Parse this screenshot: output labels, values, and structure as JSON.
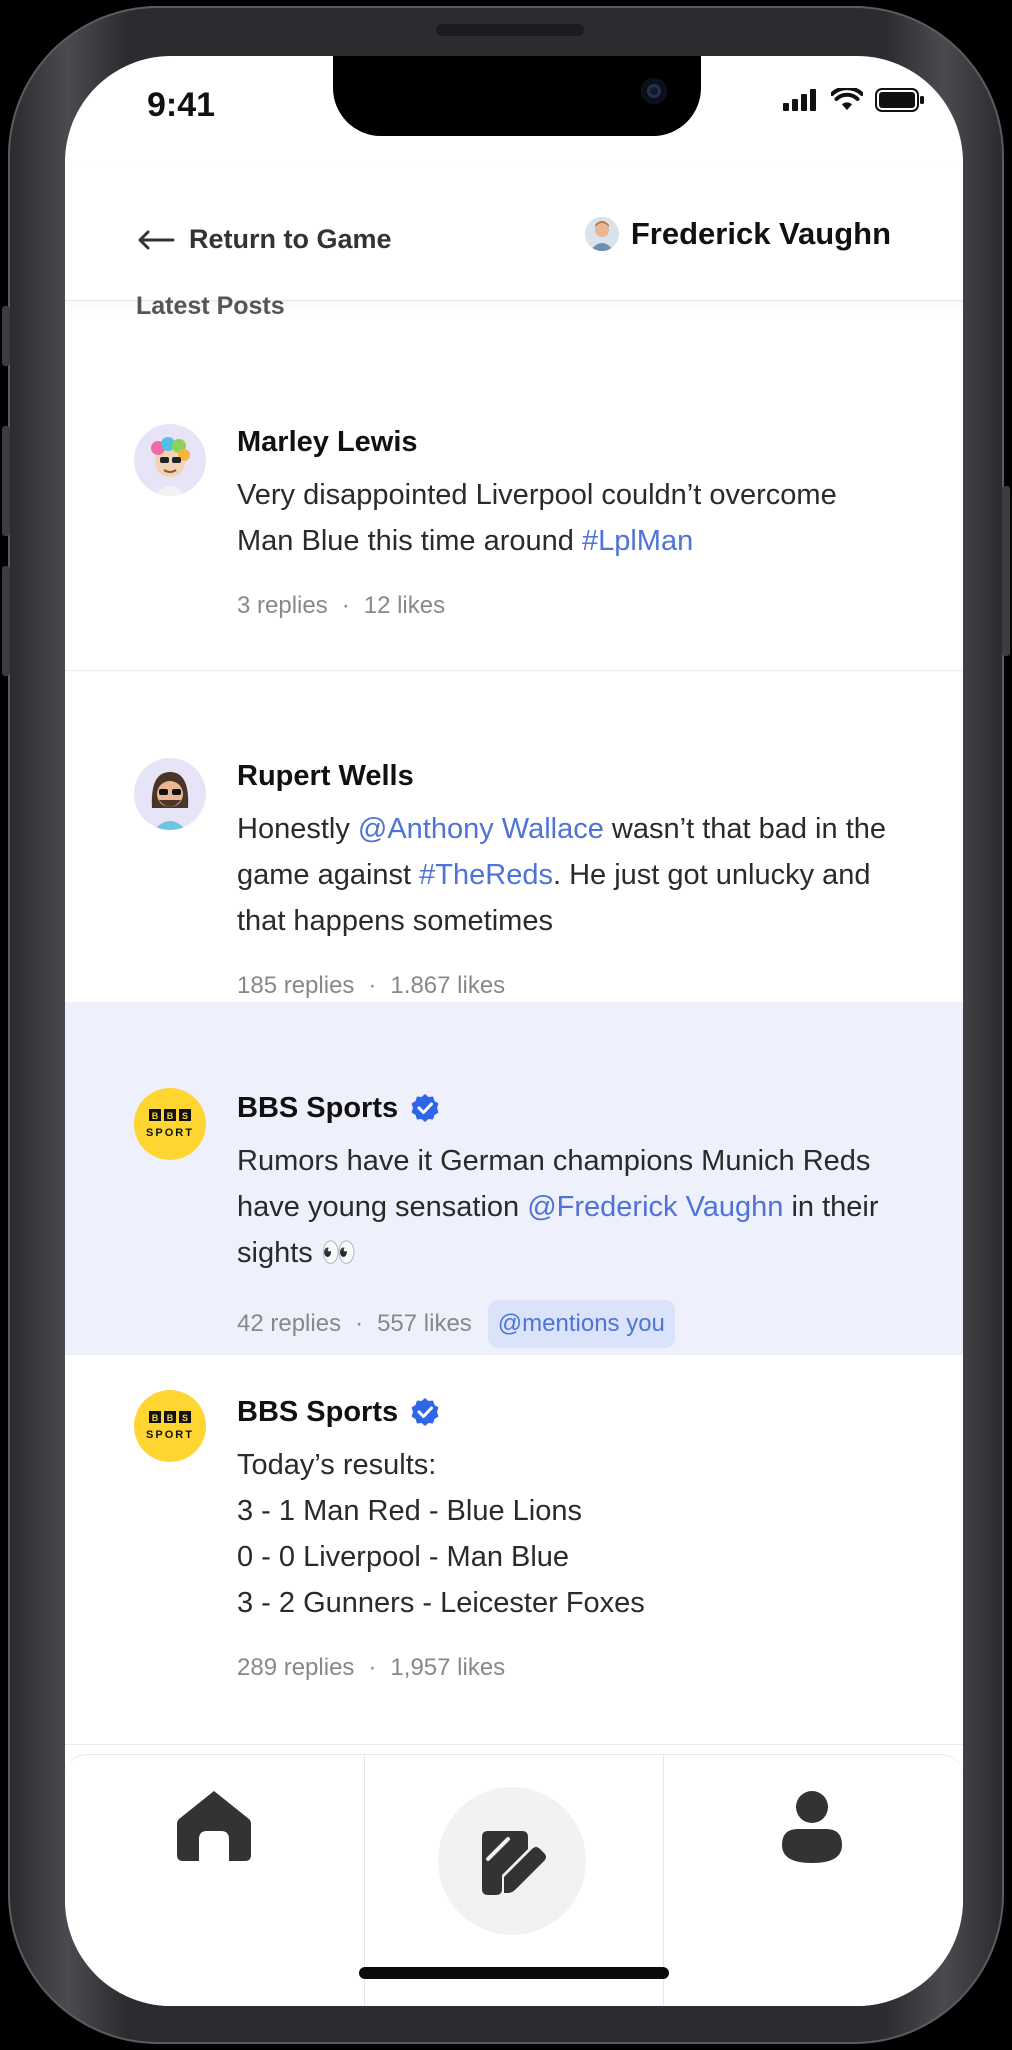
{
  "status": {
    "time": "9:41"
  },
  "header": {
    "back_label": "Return to Game",
    "user_name": "Frederick Vaughn"
  },
  "section_title": "Latest Posts",
  "posts": [
    {
      "author": "Marley Lewis",
      "verified": false,
      "text_parts": [
        "Very disappointed Liverpool couldn’t overcome Man Blue this time around ",
        "#LplMan"
      ],
      "replies": "3 replies",
      "likes": "12 likes"
    },
    {
      "author": "Rupert Wells",
      "verified": false,
      "text_parts": [
        "Honestly ",
        "@Anthony Wallace",
        " wasn’t that bad in the game against ",
        "#TheReds",
        ". He just got unlucky and that happens sometimes"
      ],
      "replies": "185 replies",
      "likes": "1.867 likes"
    },
    {
      "author": "BBS Sports",
      "verified": true,
      "text_parts": [
        "Rumors have it German champions Munich Reds have young sensation ",
        "@Frederick Vaughn",
        " in their sights 👀"
      ],
      "replies": "42 replies",
      "likes": "557 likes",
      "chip": "@mentions you"
    },
    {
      "author": "BBS Sports",
      "verified": true,
      "text_lines": [
        "Today’s results:",
        "3 - 1 Man Red - Blue Lions",
        "0 - 0 Liverpool - Man Blue",
        "3 - 2 Gunners - Leicester Foxes"
      ],
      "replies": "289 replies",
      "likes": "1,957 likes"
    }
  ],
  "bbs_logo": {
    "top": "BBS",
    "bottom": "SPORT"
  },
  "colors": {
    "accent": "#4f73d6",
    "highlight_bg": "#eef0fb",
    "verified": "#2f66e8",
    "bbs_yellow": "#ffd531"
  },
  "tabbar": {
    "items": [
      "home-icon",
      "compose-icon",
      "profile-icon"
    ]
  }
}
